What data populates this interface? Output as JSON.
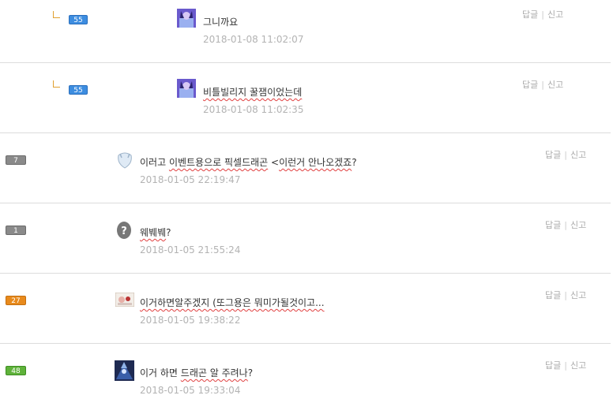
{
  "actions": {
    "reply": "답글",
    "sep": "|",
    "report": "신고"
  },
  "comments": [
    {
      "level": "55",
      "text": "그니까요",
      "date": "2018-01-08  11:02:07"
    },
    {
      "level": "55",
      "text": "비틀빌리지 꿀잼이었는데",
      "date": "2018-01-08  11:02:35"
    },
    {
      "level": "7",
      "text_a": "이러고 ",
      "text_b": "이벤트용으로 픽셀드래곤",
      "text_c": " <",
      "text_d": "이런거 안나오겠죠",
      "text_e": "?",
      "date": "2018-01-05  22:19:47"
    },
    {
      "level": "1",
      "text_a": "웨붸붸",
      "text_b": "?",
      "date": "2018-01-05  21:55:24"
    },
    {
      "level": "27",
      "text": "이거하면알주겠지 (또그용은 뭐미가될것이고...",
      "date": "2018-01-05  19:38:22"
    },
    {
      "level": "48",
      "text_a": "이거 하면 ",
      "text_b": "드래곤 알 주려나",
      "text_c": "?",
      "date": "2018-01-05  19:33:04"
    }
  ],
  "colors": {
    "badge_blue": "#3d8de0",
    "badge_gray": "#8a8a8a",
    "badge_orange": "#e88a1c",
    "badge_green": "#5fb23a"
  }
}
